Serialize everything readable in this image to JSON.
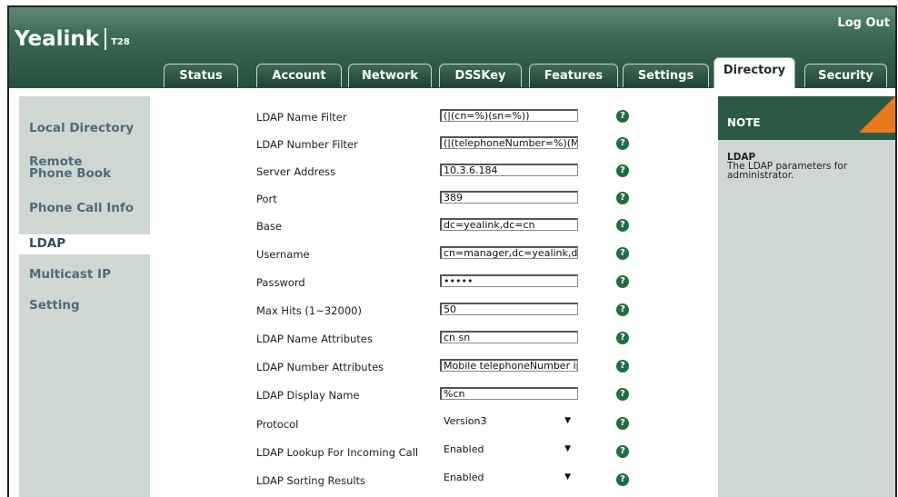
{
  "header": {
    "brand": "Yealink",
    "model": "T28",
    "logout": "Log Out"
  },
  "tabs": [
    {
      "label": "Status",
      "active": false
    },
    {
      "label": "Account",
      "active": false
    },
    {
      "label": "Network",
      "active": false
    },
    {
      "label": "DSSKey",
      "active": false
    },
    {
      "label": "Features",
      "active": false
    },
    {
      "label": "Settings",
      "active": false
    },
    {
      "label": "Directory",
      "active": true
    },
    {
      "label": "Security",
      "active": false
    }
  ],
  "sidebar": {
    "items": [
      {
        "label": "Local Directory"
      },
      {
        "label": "Remote Phone Book"
      },
      {
        "label": "Phone Call Info"
      },
      {
        "label": "LDAP"
      },
      {
        "label": "Multicast IP"
      },
      {
        "label": "Setting"
      }
    ]
  },
  "form": {
    "rows": [
      {
        "label": "LDAP Name Filter",
        "value": "(|(cn=%)(sn=%))"
      },
      {
        "label": "LDAP Number Filter",
        "value": "(|(telephoneNumber=%)(M"
      },
      {
        "label": "Server Address",
        "value": "10.3.6.184"
      },
      {
        "label": "Port",
        "value": "389"
      },
      {
        "label": "Base",
        "value": "dc=yealink,dc=cn"
      },
      {
        "label": "Username",
        "value": "cn=manager,dc=yealink,dc="
      },
      {
        "label": "Password",
        "value": "•••••"
      },
      {
        "label": "Max Hits (1~32000)",
        "value": "50"
      },
      {
        "label": "LDAP Name Attributes",
        "value": "cn sn"
      },
      {
        "label": "LDAP Number Attributes",
        "value": "Mobile telephoneNumber ipP"
      },
      {
        "label": "LDAP Display Name",
        "value": "%cn"
      },
      {
        "label": "Protocol",
        "value": "Version3"
      },
      {
        "label": "LDAP Lookup For Incoming Call",
        "value": "Enabled"
      },
      {
        "label": "LDAP Sorting Results",
        "value": "Enabled"
      }
    ],
    "help_glyph": "?"
  },
  "note": {
    "title": "NOTE",
    "subtitle": "LDAP",
    "text": "The LDAP parameters for administrator."
  },
  "colors": {
    "header_dark": "#264f3c",
    "sidebar_bg": "#cfd7d3",
    "note_corner": "#e87a1c",
    "help_icon": "#1f6e43"
  },
  "icons": {
    "help": "help-icon",
    "dropdown": "chevron-down-icon"
  }
}
